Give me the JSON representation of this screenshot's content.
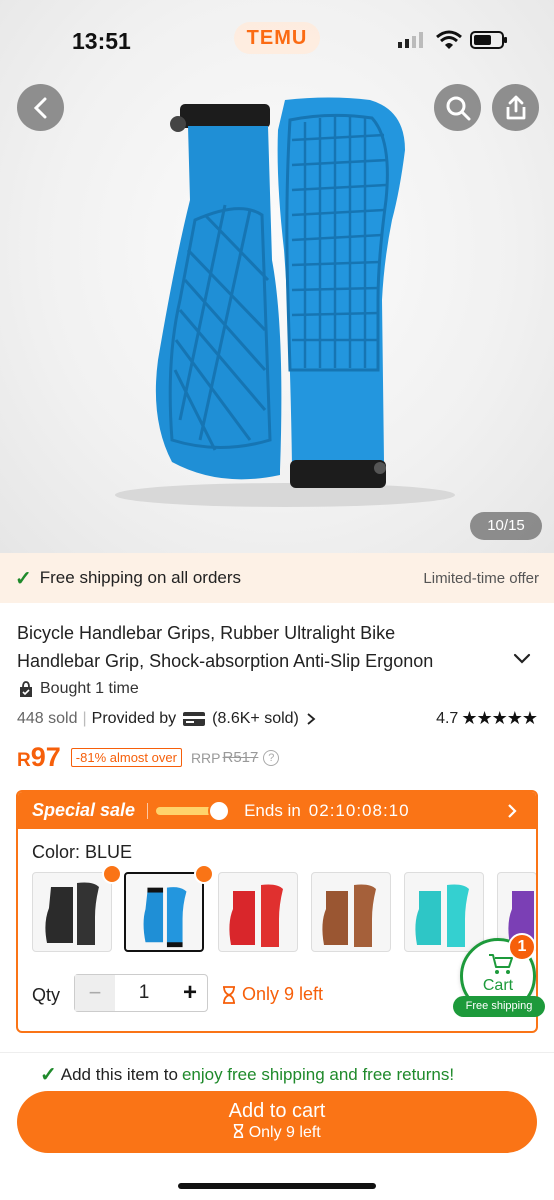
{
  "status_bar": {
    "time": "13:51",
    "brand": "TEMU"
  },
  "hero": {
    "image_counter": "10/15"
  },
  "shipping_strip": {
    "text": "Free shipping on all orders",
    "offer": "Limited-time offer"
  },
  "product": {
    "title_line1": "Bicycle Handlebar Grips, Rubber Ultralight Bike",
    "title_line2": "Handlebar Grip, Shock-absorption Anti-Slip Ergonon",
    "bought": "Bought 1 time",
    "sold": "448 sold",
    "provided_by": "Provided by",
    "provider_sold": "(8.6K+ sold)",
    "rating": "4.7",
    "stars": "★★★★★",
    "currency": "R",
    "price": "97",
    "discount": "-81% almost over",
    "rrp_label": "RRP",
    "rrp_value": "R517"
  },
  "sale": {
    "title": "Special sale",
    "ends_label": "Ends in",
    "countdown": "02:10:08:10",
    "color_label": "Color: BLUE",
    "swatches": [
      {
        "name": "black",
        "color": "#2b2b2b"
      },
      {
        "name": "blue",
        "color": "#1f8fd6"
      },
      {
        "name": "red",
        "color": "#d9262b"
      },
      {
        "name": "brown",
        "color": "#9a5632"
      },
      {
        "name": "cyan",
        "color": "#2ec6c6"
      },
      {
        "name": "purple",
        "color": "#7b3fb5"
      }
    ],
    "qty_label": "Qty",
    "qty_value": "1",
    "stock": "Only 9 left"
  },
  "float_cart": {
    "label": "Cart",
    "badge": "1",
    "free_shipping": "Free shipping"
  },
  "bottom": {
    "promo_prefix": "Add this item to",
    "promo_highlight": "enjoy free shipping and free returns!",
    "add_to_cart": "Add to cart",
    "add_sub": "Only 9 left"
  },
  "colors": {
    "accent": "#fa7416",
    "price": "#f65f0a",
    "green": "#1f8a2b",
    "grip_blue": "#1f8fd6"
  }
}
